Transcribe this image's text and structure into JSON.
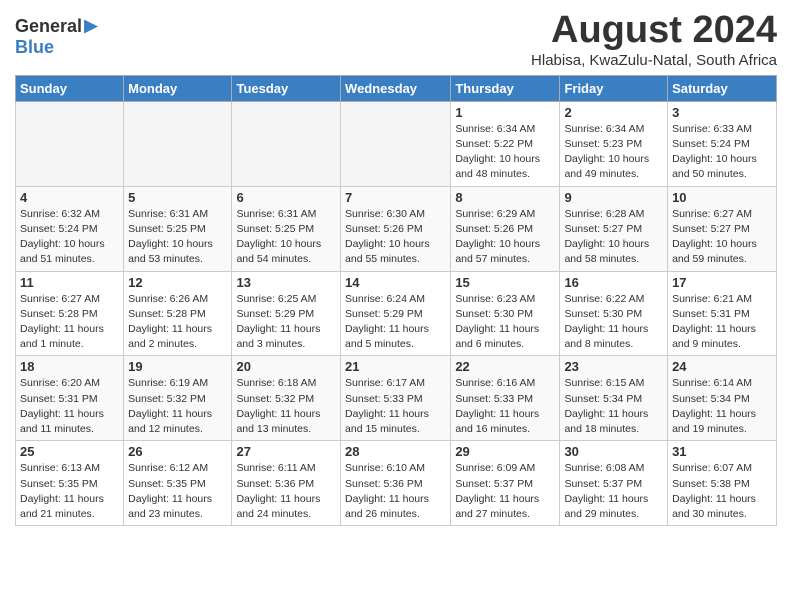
{
  "header": {
    "logo_general": "General",
    "logo_blue": "Blue",
    "month_title": "August 2024",
    "location": "Hlabisa, KwaZulu-Natal, South Africa"
  },
  "weekdays": [
    "Sunday",
    "Monday",
    "Tuesday",
    "Wednesday",
    "Thursday",
    "Friday",
    "Saturday"
  ],
  "weeks": [
    [
      {
        "day": "",
        "info": ""
      },
      {
        "day": "",
        "info": ""
      },
      {
        "day": "",
        "info": ""
      },
      {
        "day": "",
        "info": ""
      },
      {
        "day": "1",
        "info": "Sunrise: 6:34 AM\nSunset: 5:22 PM\nDaylight: 10 hours\nand 48 minutes."
      },
      {
        "day": "2",
        "info": "Sunrise: 6:34 AM\nSunset: 5:23 PM\nDaylight: 10 hours\nand 49 minutes."
      },
      {
        "day": "3",
        "info": "Sunrise: 6:33 AM\nSunset: 5:24 PM\nDaylight: 10 hours\nand 50 minutes."
      }
    ],
    [
      {
        "day": "4",
        "info": "Sunrise: 6:32 AM\nSunset: 5:24 PM\nDaylight: 10 hours\nand 51 minutes."
      },
      {
        "day": "5",
        "info": "Sunrise: 6:31 AM\nSunset: 5:25 PM\nDaylight: 10 hours\nand 53 minutes."
      },
      {
        "day": "6",
        "info": "Sunrise: 6:31 AM\nSunset: 5:25 PM\nDaylight: 10 hours\nand 54 minutes."
      },
      {
        "day": "7",
        "info": "Sunrise: 6:30 AM\nSunset: 5:26 PM\nDaylight: 10 hours\nand 55 minutes."
      },
      {
        "day": "8",
        "info": "Sunrise: 6:29 AM\nSunset: 5:26 PM\nDaylight: 10 hours\nand 57 minutes."
      },
      {
        "day": "9",
        "info": "Sunrise: 6:28 AM\nSunset: 5:27 PM\nDaylight: 10 hours\nand 58 minutes."
      },
      {
        "day": "10",
        "info": "Sunrise: 6:27 AM\nSunset: 5:27 PM\nDaylight: 10 hours\nand 59 minutes."
      }
    ],
    [
      {
        "day": "11",
        "info": "Sunrise: 6:27 AM\nSunset: 5:28 PM\nDaylight: 11 hours\nand 1 minute."
      },
      {
        "day": "12",
        "info": "Sunrise: 6:26 AM\nSunset: 5:28 PM\nDaylight: 11 hours\nand 2 minutes."
      },
      {
        "day": "13",
        "info": "Sunrise: 6:25 AM\nSunset: 5:29 PM\nDaylight: 11 hours\nand 3 minutes."
      },
      {
        "day": "14",
        "info": "Sunrise: 6:24 AM\nSunset: 5:29 PM\nDaylight: 11 hours\nand 5 minutes."
      },
      {
        "day": "15",
        "info": "Sunrise: 6:23 AM\nSunset: 5:30 PM\nDaylight: 11 hours\nand 6 minutes."
      },
      {
        "day": "16",
        "info": "Sunrise: 6:22 AM\nSunset: 5:30 PM\nDaylight: 11 hours\nand 8 minutes."
      },
      {
        "day": "17",
        "info": "Sunrise: 6:21 AM\nSunset: 5:31 PM\nDaylight: 11 hours\nand 9 minutes."
      }
    ],
    [
      {
        "day": "18",
        "info": "Sunrise: 6:20 AM\nSunset: 5:31 PM\nDaylight: 11 hours\nand 11 minutes."
      },
      {
        "day": "19",
        "info": "Sunrise: 6:19 AM\nSunset: 5:32 PM\nDaylight: 11 hours\nand 12 minutes."
      },
      {
        "day": "20",
        "info": "Sunrise: 6:18 AM\nSunset: 5:32 PM\nDaylight: 11 hours\nand 13 minutes."
      },
      {
        "day": "21",
        "info": "Sunrise: 6:17 AM\nSunset: 5:33 PM\nDaylight: 11 hours\nand 15 minutes."
      },
      {
        "day": "22",
        "info": "Sunrise: 6:16 AM\nSunset: 5:33 PM\nDaylight: 11 hours\nand 16 minutes."
      },
      {
        "day": "23",
        "info": "Sunrise: 6:15 AM\nSunset: 5:34 PM\nDaylight: 11 hours\nand 18 minutes."
      },
      {
        "day": "24",
        "info": "Sunrise: 6:14 AM\nSunset: 5:34 PM\nDaylight: 11 hours\nand 19 minutes."
      }
    ],
    [
      {
        "day": "25",
        "info": "Sunrise: 6:13 AM\nSunset: 5:35 PM\nDaylight: 11 hours\nand 21 minutes."
      },
      {
        "day": "26",
        "info": "Sunrise: 6:12 AM\nSunset: 5:35 PM\nDaylight: 11 hours\nand 23 minutes."
      },
      {
        "day": "27",
        "info": "Sunrise: 6:11 AM\nSunset: 5:36 PM\nDaylight: 11 hours\nand 24 minutes."
      },
      {
        "day": "28",
        "info": "Sunrise: 6:10 AM\nSunset: 5:36 PM\nDaylight: 11 hours\nand 26 minutes."
      },
      {
        "day": "29",
        "info": "Sunrise: 6:09 AM\nSunset: 5:37 PM\nDaylight: 11 hours\nand 27 minutes."
      },
      {
        "day": "30",
        "info": "Sunrise: 6:08 AM\nSunset: 5:37 PM\nDaylight: 11 hours\nand 29 minutes."
      },
      {
        "day": "31",
        "info": "Sunrise: 6:07 AM\nSunset: 5:38 PM\nDaylight: 11 hours\nand 30 minutes."
      }
    ]
  ]
}
